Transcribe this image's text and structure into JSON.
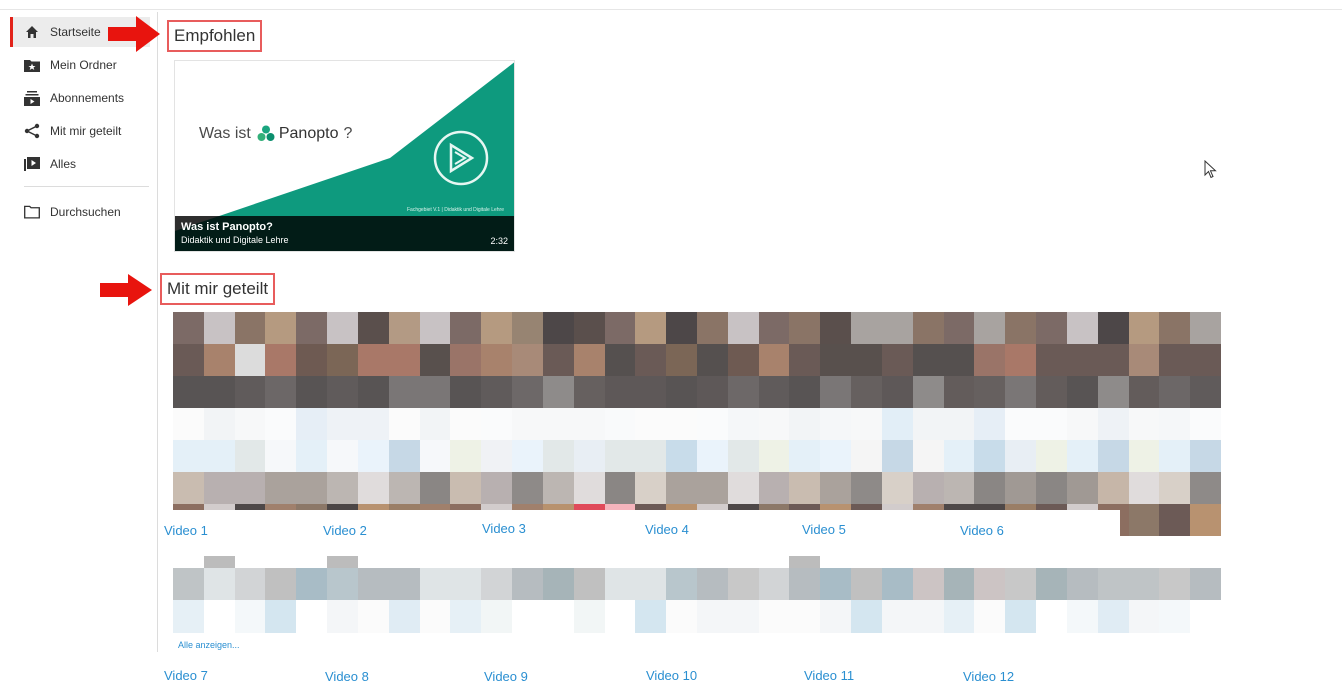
{
  "sidebar": {
    "items": [
      {
        "label": "Startseite",
        "icon": "home-icon"
      },
      {
        "label": "Mein Ordner",
        "icon": "star-folder-icon"
      },
      {
        "label": "Abonnements",
        "icon": "subscriptions-icon"
      },
      {
        "label": "Mit mir geteilt",
        "icon": "share-icon"
      },
      {
        "label": "Alles",
        "icon": "play-list-icon"
      },
      {
        "label": "Durchsuchen",
        "icon": "folder-icon"
      }
    ]
  },
  "sections": {
    "recommended": {
      "title": "Empfohlen",
      "video": {
        "thumb_text": "Was ist",
        "brand": "Panopto",
        "thumb_suffix": "?",
        "small_caption": "Fachgebiet V.1 | Didaktik und Digitale Lehre",
        "title": "Was ist Panopto?",
        "subtitle": "Didaktik und Digitale Lehre",
        "duration": "2:32"
      }
    },
    "shared": {
      "title": "Mit mir geteilt",
      "videos_row1": [
        "Video 1",
        "Video 2",
        "Video 3",
        "Video 4",
        "Video 5",
        "Video 6"
      ],
      "videos_row2": [
        "Video 7",
        "Video 8",
        "Video 9",
        "Video 10",
        "Video 11",
        "Video 12"
      ],
      "show_all": "Alle anzeigen..."
    }
  },
  "colors": {
    "accent_red": "#e2231a",
    "link_blue": "#2a8fd1",
    "panopto_green": "#0e9a7e"
  }
}
